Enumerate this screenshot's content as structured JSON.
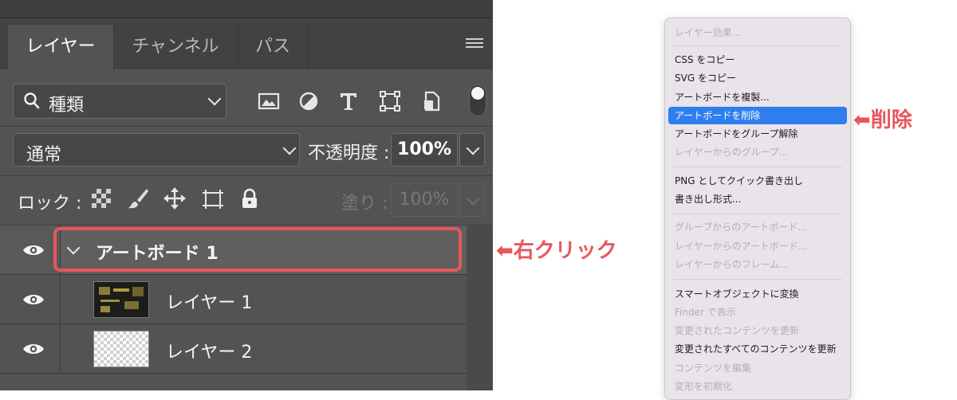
{
  "panel": {
    "tabs": [
      {
        "label": "レイヤー",
        "active": true
      },
      {
        "label": "チャンネル",
        "active": false
      },
      {
        "label": "パス",
        "active": false
      }
    ],
    "filter": {
      "value": "種類"
    },
    "blend_mode": {
      "value": "通常"
    },
    "opacity": {
      "label": "不透明度 :",
      "value": "100%"
    },
    "lock": {
      "label": "ロック :"
    },
    "fill": {
      "label": "塗り :",
      "value": "100%"
    },
    "layers": [
      {
        "name": "アートボード 1",
        "type": "artboard",
        "expanded": true,
        "visible": true
      },
      {
        "name": "レイヤー 1",
        "type": "layer",
        "visible": true
      },
      {
        "name": "レイヤー 2",
        "type": "layer",
        "visible": true
      }
    ]
  },
  "annotations": {
    "right_click": "⬅右クリック",
    "delete": "⬅削除"
  },
  "context_menu": {
    "items": [
      {
        "label": "レイヤー効果...",
        "disabled": true
      },
      {
        "separator": true
      },
      {
        "label": "CSS をコピー",
        "disabled": false
      },
      {
        "label": "SVG をコピー",
        "disabled": false
      },
      {
        "label": "アートボードを複製...",
        "disabled": false
      },
      {
        "label": "アートボードを削除",
        "disabled": false,
        "selected": true
      },
      {
        "label": "アートボードをグループ解除",
        "disabled": false
      },
      {
        "label": "レイヤーからのグループ...",
        "disabled": true
      },
      {
        "separator": true
      },
      {
        "label": "PNG としてクイック書き出し",
        "disabled": false
      },
      {
        "label": "書き出し形式...",
        "disabled": false
      },
      {
        "separator": true
      },
      {
        "label": "グループからのアートボード...",
        "disabled": true
      },
      {
        "label": "レイヤーからのアートボード...",
        "disabled": true
      },
      {
        "label": "レイヤーからのフレーム...",
        "disabled": true
      },
      {
        "separator": true
      },
      {
        "label": "スマートオブジェクトに変換",
        "disabled": false
      },
      {
        "label": "Finder で表示",
        "disabled": true
      },
      {
        "label": "変更されたコンテンツを更新",
        "disabled": true
      },
      {
        "label": "変更されたすべてのコンテンツを更新",
        "disabled": false
      },
      {
        "label": "コンテンツを編集",
        "disabled": true
      },
      {
        "label": "変形を初期化",
        "disabled": true
      }
    ]
  },
  "colors": {
    "panel_bg": "#535353",
    "annotation": "#e8565c",
    "menu_selected": "#2f7ef0"
  }
}
